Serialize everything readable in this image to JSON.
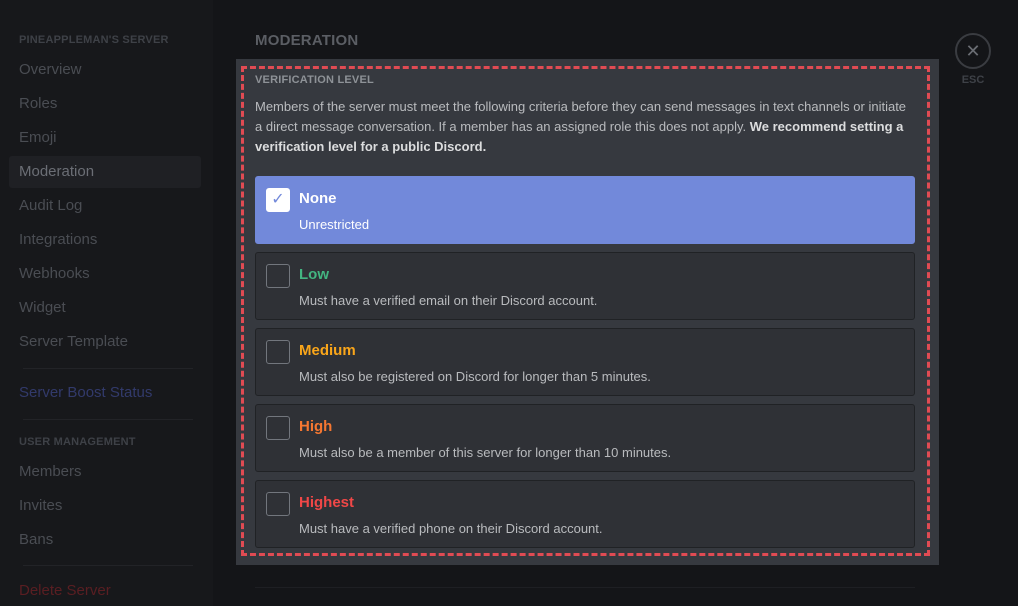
{
  "sidebar": {
    "server_header": "PINEAPPLEMAN'S SERVER",
    "items": [
      {
        "label": "Overview"
      },
      {
        "label": "Roles"
      },
      {
        "label": "Emoji"
      },
      {
        "label": "Moderation",
        "selected": true
      },
      {
        "label": "Audit Log"
      },
      {
        "label": "Integrations"
      },
      {
        "label": "Webhooks"
      },
      {
        "label": "Widget"
      },
      {
        "label": "Server Template"
      }
    ],
    "boost_status": "Server Boost Status",
    "user_management_header": "USER MANAGEMENT",
    "user_items": [
      {
        "label": "Members"
      },
      {
        "label": "Invites"
      },
      {
        "label": "Bans"
      }
    ],
    "delete_server": "Delete Server"
  },
  "main": {
    "title": "MODERATION",
    "close": {
      "icon": "close-icon",
      "label": "ESC"
    },
    "verification": {
      "label": "VERIFICATION LEVEL",
      "description": "Members of the server must meet the following criteria before they can send messages in text channels or initiate a direct message conversation. If a member has an assigned role this does not apply. ",
      "description_bold": "We recommend setting a verification level for a public Discord.",
      "options": [
        {
          "name": "None",
          "desc": "Unrestricted",
          "color": "#ffffff",
          "checked": true
        },
        {
          "name": "Low",
          "desc": "Must have a verified email on their Discord account.",
          "color": "#43b581",
          "checked": false
        },
        {
          "name": "Medium",
          "desc": "Must also be registered on Discord for longer than 5 minutes.",
          "color": "#faa61a",
          "checked": false
        },
        {
          "name": "High",
          "desc": "Must also be a member of this server for longer than 10 minutes.",
          "color": "#f57731",
          "checked": false
        },
        {
          "name": "Highest",
          "desc": "Must have a verified phone on their Discord account.",
          "color": "#f04747",
          "checked": false
        }
      ]
    }
  },
  "colors": {
    "accent": "#7289da",
    "highlight_dash": "#e04b53"
  }
}
